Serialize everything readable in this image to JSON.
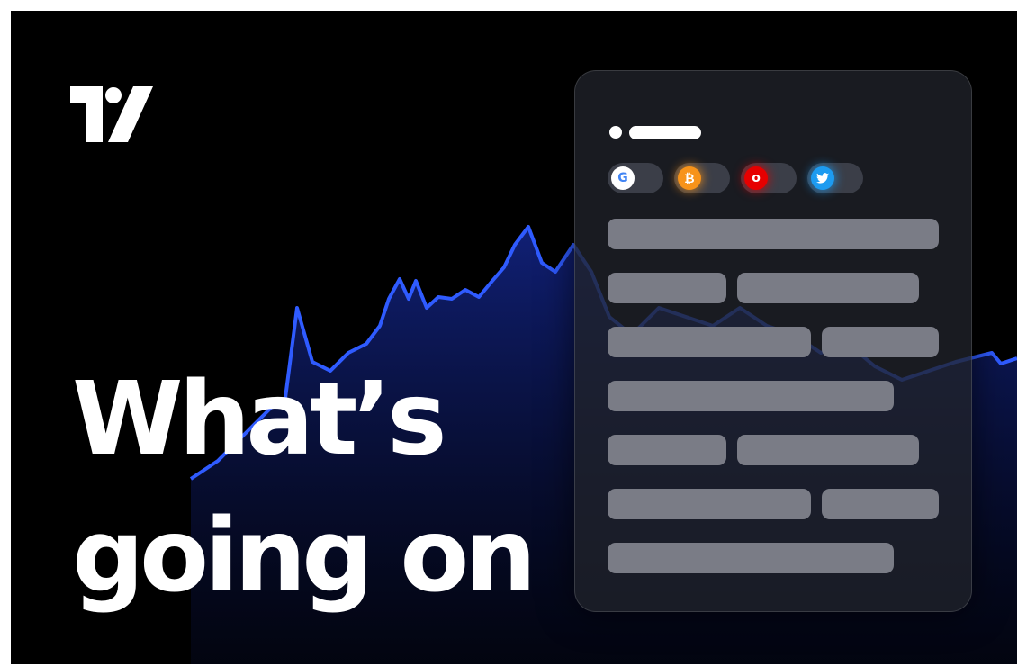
{
  "headline": {
    "line1": "What’s",
    "line2": "going on"
  },
  "logo": {
    "icon": "tradingview-logo-icon",
    "color": "#ffffff"
  },
  "card": {
    "chips": [
      {
        "icon": "google-icon",
        "glyph": "G",
        "color": "#ffffff"
      },
      {
        "icon": "bitcoin-icon",
        "glyph": "₿",
        "color": "#f7931a"
      },
      {
        "icon": "vodafone-icon",
        "glyph": "o",
        "color": "#e60000"
      },
      {
        "icon": "twitter-icon",
        "glyph": "🐦",
        "color": "#1d9bf0"
      }
    ]
  },
  "colors": {
    "background": "#000000",
    "chart_line": "#2f5bff",
    "placeholder_bar": "#7a7c86"
  }
}
